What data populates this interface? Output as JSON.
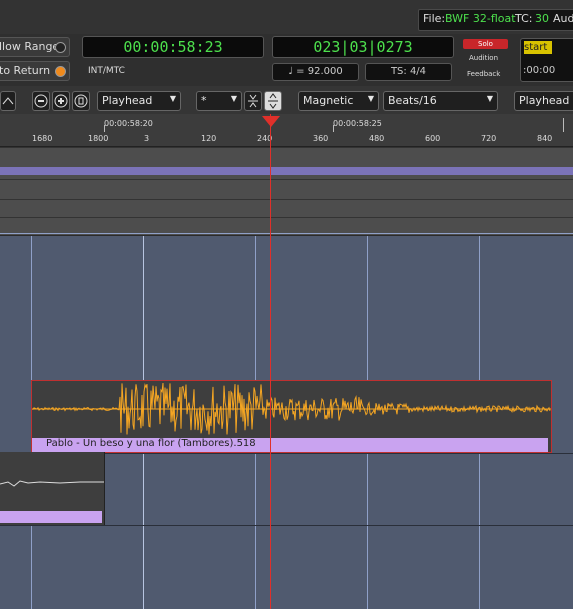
{
  "status": {
    "file_label": "File:",
    "file_value": "BWF 32-float",
    "tc_label": "TC:",
    "tc_value": "30",
    "audio_label": "Aud"
  },
  "transport": {
    "follow_range": "llow Range",
    "auto_return": "to Return",
    "primary_clock": "00:00:58:23",
    "secondary_clock": "023|03|0273",
    "sync_source": "INT/MTC",
    "tempo": "♩ = 92.000",
    "time_signature": "TS: 4/4",
    "solo": "Solo",
    "audition": "Audition",
    "feedback": "Feedback",
    "start_label": "start",
    "start_time": ":00:00"
  },
  "toolbar": {
    "playhead_left": "Playhead",
    "grid_value": "*",
    "snap_mode": "Magnetic",
    "grid_type": "Beats/16",
    "playhead_right": "Playhead"
  },
  "ruler": {
    "timecode_labels": [
      "00:00:58:20",
      "00:00:58:25"
    ],
    "bbt_labels": [
      "1680",
      "1800",
      "3",
      "120",
      "240",
      "360",
      "480",
      "600",
      "720",
      "840"
    ]
  },
  "region": {
    "name": "Pablo - Un beso y una flor (Tambores).518"
  },
  "colors": {
    "waveform": "#f5a623",
    "playhead": "#e0302a",
    "region_name_bg": "#c9a3f0",
    "canvas_bg": "#505a6f",
    "clock_green": "#4de04d"
  }
}
